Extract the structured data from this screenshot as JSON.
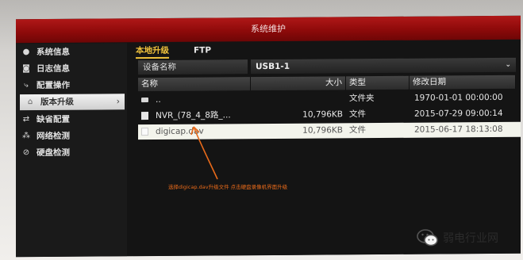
{
  "window": {
    "title": "系统维护"
  },
  "sidebar": {
    "items": [
      {
        "label": "系统信息",
        "icon": "info-icon"
      },
      {
        "label": "日志信息",
        "icon": "log-icon"
      },
      {
        "label": "配置操作",
        "icon": "config-icon"
      },
      {
        "label": "版本升级",
        "icon": "upgrade-icon",
        "active": true
      },
      {
        "label": "缺省配置",
        "icon": "default-icon"
      },
      {
        "label": "网络检测",
        "icon": "network-icon"
      },
      {
        "label": "硬盘检测",
        "icon": "disk-icon"
      }
    ]
  },
  "tabs": [
    {
      "label": "本地升级",
      "active": true
    },
    {
      "label": "FTP",
      "active": false
    }
  ],
  "device": {
    "label": "设备名称",
    "value": "USB1-1"
  },
  "table": {
    "columns": [
      "名称",
      "大小",
      "类型",
      "修改日期"
    ],
    "rows": [
      {
        "name": "..",
        "size": "",
        "type": "文件夹",
        "date": "1970-01-01 00:00:00",
        "icon": "folder-icon"
      },
      {
        "name": "NVR_(78_4_8路_...",
        "size": "10,796KB",
        "type": "文件",
        "date": "2015-07-29 09:00:14",
        "icon": "file-icon"
      },
      {
        "name": "digicap.dav",
        "size": "10,796KB",
        "type": "文件",
        "date": "2015-06-17 18:13:08",
        "icon": "file-icon",
        "selected": true
      }
    ]
  },
  "annotation": {
    "text": "选择digicap.dav升级文件 点击硬盘录像机界面升级",
    "color": "#e86a1a"
  },
  "watermark": {
    "text": "弱电行业网"
  }
}
